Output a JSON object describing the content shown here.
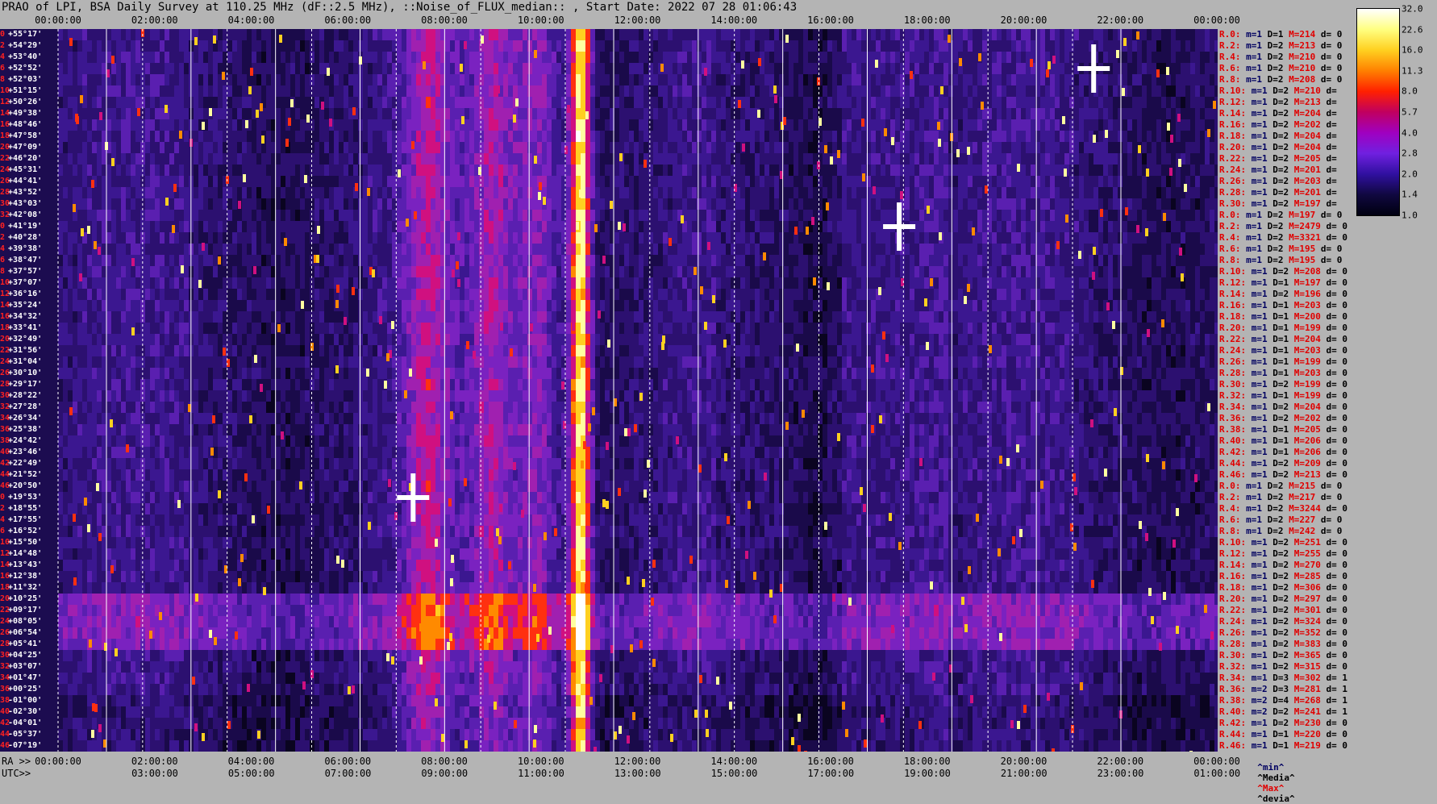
{
  "title": "PRAO of LPI, BSA Daily Survey at 110.25 MHz (dF::2.5 MHz), ::Noise_of_FLUX_median:: , Start Date: 2022 07 28 01:06:43",
  "chart_data": {
    "type": "heatmap",
    "title": "PRAO of LPI, BSA Daily Survey at 110.25 MHz (dF::2.5 MHz), ::Noise_of_FLUX_median:: , Start Date: 2022 07 28 01:06:43",
    "top_axis_labels": [
      "00:00:00",
      "02:00:00",
      "04:00:00",
      "06:00:00",
      "08:00:00",
      "10:00:00",
      "12:00:00",
      "14:00:00",
      "16:00:00",
      "18:00:00",
      "20:00:00",
      "22:00:00",
      "00:00:00"
    ],
    "ra_prefix": "RA >>",
    "ra_labels": [
      "00:00:00",
      "02:00:00",
      "04:00:00",
      "06:00:00",
      "08:00:00",
      "10:00:00",
      "12:00:00",
      "14:00:00",
      "16:00:00",
      "18:00:00",
      "20:00:00",
      "22:00:00",
      "00:00:00"
    ],
    "utc_prefix": "UTC>>",
    "utc_labels": [
      "03:00:00",
      "05:00:00",
      "07:00:00",
      "09:00:00",
      "11:00:00",
      "13:00:00",
      "15:00:00",
      "17:00:00",
      "19:00:00",
      "21:00:00",
      "23:00:00",
      "01:00:00"
    ],
    "dec_labels": [
      {
        "idx": "0",
        "dec": "+55°17'"
      },
      {
        "idx": "2",
        "dec": "+54°29'"
      },
      {
        "idx": "4",
        "dec": "+53°40'"
      },
      {
        "idx": "6",
        "dec": "+52°52'"
      },
      {
        "idx": "8",
        "dec": "+52°03'"
      },
      {
        "idx": "10",
        "dec": "+51°15'"
      },
      {
        "idx": "12",
        "dec": "+50°26'"
      },
      {
        "idx": "14",
        "dec": "+49°38'"
      },
      {
        "idx": "16",
        "dec": "+48°46'"
      },
      {
        "idx": "18",
        "dec": "+47°58'"
      },
      {
        "idx": "20",
        "dec": "+47°09'"
      },
      {
        "idx": "22",
        "dec": "+46°20'"
      },
      {
        "idx": "24",
        "dec": "+45°31'"
      },
      {
        "idx": "26",
        "dec": "+44°41'"
      },
      {
        "idx": "28",
        "dec": "+43°52'"
      },
      {
        "idx": "30",
        "dec": "+43°03'"
      },
      {
        "idx": "32",
        "dec": "+42°08'"
      },
      {
        "idx": "0",
        "dec": "+41°19'"
      },
      {
        "idx": "2",
        "dec": "+40°28'"
      },
      {
        "idx": "4",
        "dec": "+39°38'"
      },
      {
        "idx": "6",
        "dec": "+38°47'"
      },
      {
        "idx": "8",
        "dec": "+37°57'"
      },
      {
        "idx": "10",
        "dec": "+37°07'"
      },
      {
        "idx": "12",
        "dec": "+36°16'"
      },
      {
        "idx": "14",
        "dec": "+35°24'"
      },
      {
        "idx": "16",
        "dec": "+34°32'"
      },
      {
        "idx": "18",
        "dec": "+33°41'"
      },
      {
        "idx": "20",
        "dec": "+32°49'"
      },
      {
        "idx": "22",
        "dec": "+31°56'"
      },
      {
        "idx": "24",
        "dec": "+31°04'"
      },
      {
        "idx": "26",
        "dec": "+30°10'"
      },
      {
        "idx": "28",
        "dec": "+29°17'"
      },
      {
        "idx": "30",
        "dec": "+28°22'"
      },
      {
        "idx": "32",
        "dec": "+27°28'"
      },
      {
        "idx": "34",
        "dec": "+26°34'"
      },
      {
        "idx": "36",
        "dec": "+25°38'"
      },
      {
        "idx": "38",
        "dec": "+24°42'"
      },
      {
        "idx": "40",
        "dec": "+23°46'"
      },
      {
        "idx": "42",
        "dec": "+22°49'"
      },
      {
        "idx": "44",
        "dec": "+21°52'"
      },
      {
        "idx": "46",
        "dec": "+20°50'"
      },
      {
        "idx": "0",
        "dec": "+19°53'"
      },
      {
        "idx": "2",
        "dec": "+18°55'"
      },
      {
        "idx": "4",
        "dec": "+17°55'"
      },
      {
        "idx": "6",
        "dec": "+16°52'"
      },
      {
        "idx": "10",
        "dec": "+15°50'"
      },
      {
        "idx": "12",
        "dec": "+14°48'"
      },
      {
        "idx": "14",
        "dec": "+13°43'"
      },
      {
        "idx": "16",
        "dec": "+12°38'"
      },
      {
        "idx": "18",
        "dec": "+11°32'"
      },
      {
        "idx": "20",
        "dec": "+10°25'"
      },
      {
        "idx": "22",
        "dec": "+09°17'"
      },
      {
        "idx": "24",
        "dec": "+08°05'"
      },
      {
        "idx": "26",
        "dec": "+06°54'"
      },
      {
        "idx": "28",
        "dec": "+05°41'"
      },
      {
        "idx": "30",
        "dec": "+04°25'"
      },
      {
        "idx": "32",
        "dec": "+03°07'"
      },
      {
        "idx": "34",
        "dec": "+01°47'"
      },
      {
        "idx": "36",
        "dec": "+00°25'"
      },
      {
        "idx": "38",
        "dec": "-01°00'"
      },
      {
        "idx": "40",
        "dec": "-02°30'"
      },
      {
        "idx": "42",
        "dec": "-04°01'"
      },
      {
        "idx": "44",
        "dec": "-05°37'"
      },
      {
        "idx": "46",
        "dec": "-07°19'"
      }
    ],
    "stats": [
      {
        "r": "R.0:",
        "m": "m=1",
        "d": "D=1",
        "max": "M=214",
        "dev": "d= 0"
      },
      {
        "r": "R.2:",
        "m": "m=1",
        "d": "D=2",
        "max": "M=213",
        "dev": "d= 0"
      },
      {
        "r": "R.4:",
        "m": "m=1",
        "d": "D=2",
        "max": "M=210",
        "dev": "d= 0"
      },
      {
        "r": "R.6:",
        "m": "m=1",
        "d": "D=2",
        "max": "M=210",
        "dev": "d= 0"
      },
      {
        "r": "R.8:",
        "m": "m=1",
        "d": "D=2",
        "max": "M=208",
        "dev": "d= 0"
      },
      {
        "r": "R.10:",
        "m": "m=1",
        "d": "D=2",
        "max": "M=210",
        "dev": "d="
      },
      {
        "r": "R.12:",
        "m": "m=1",
        "d": "D=2",
        "max": "M=213",
        "dev": "d="
      },
      {
        "r": "R.14:",
        "m": "m=1",
        "d": "D=2",
        "max": "M=204",
        "dev": "d="
      },
      {
        "r": "R.16:",
        "m": "m=1",
        "d": "D=2",
        "max": "M=202",
        "dev": "d="
      },
      {
        "r": "R.18:",
        "m": "m=1",
        "d": "D=2",
        "max": "M=204",
        "dev": "d="
      },
      {
        "r": "R.20:",
        "m": "m=1",
        "d": "D=2",
        "max": "M=204",
        "dev": "d="
      },
      {
        "r": "R.22:",
        "m": "m=1",
        "d": "D=2",
        "max": "M=205",
        "dev": "d="
      },
      {
        "r": "R.24:",
        "m": "m=1",
        "d": "D=2",
        "max": "M=201",
        "dev": "d="
      },
      {
        "r": "R.26:",
        "m": "m=1",
        "d": "D=2",
        "max": "M=203",
        "dev": "d="
      },
      {
        "r": "R.28:",
        "m": "m=1",
        "d": "D=2",
        "max": "M=201",
        "dev": "d="
      },
      {
        "r": "R.30:",
        "m": "m=1",
        "d": "D=2",
        "max": "M=197",
        "dev": "d="
      },
      {
        "r": "R.0:",
        "m": "m=1",
        "d": "D=2",
        "max": "M=197",
        "dev": "d= 0"
      },
      {
        "r": "R.2:",
        "m": "m=1",
        "d": "D=2",
        "max": "M=2479",
        "dev": "d= 0"
      },
      {
        "r": "R.4:",
        "m": "m=1",
        "d": "D=2",
        "max": "M=3321",
        "dev": "d= 0"
      },
      {
        "r": "R.6:",
        "m": "m=1",
        "d": "D=2",
        "max": "M=195",
        "dev": "d= 0"
      },
      {
        "r": "R.8:",
        "m": "m=1",
        "d": "D=2",
        "max": "M=195",
        "dev": "d= 0"
      },
      {
        "r": "R.10:",
        "m": "m=1",
        "d": "D=2",
        "max": "M=208",
        "dev": "d= 0"
      },
      {
        "r": "R.12:",
        "m": "m=1",
        "d": "D=1",
        "max": "M=197",
        "dev": "d= 0"
      },
      {
        "r": "R.14:",
        "m": "m=1",
        "d": "D=2",
        "max": "M=196",
        "dev": "d= 0"
      },
      {
        "r": "R.16:",
        "m": "m=1",
        "d": "D=1",
        "max": "M=203",
        "dev": "d= 0"
      },
      {
        "r": "R.18:",
        "m": "m=1",
        "d": "D=1",
        "max": "M=200",
        "dev": "d= 0"
      },
      {
        "r": "R.20:",
        "m": "m=1",
        "d": "D=1",
        "max": "M=199",
        "dev": "d= 0"
      },
      {
        "r": "R.22:",
        "m": "m=1",
        "d": "D=1",
        "max": "M=204",
        "dev": "d= 0"
      },
      {
        "r": "R.24:",
        "m": "m=1",
        "d": "D=1",
        "max": "M=203",
        "dev": "d= 0"
      },
      {
        "r": "R.26:",
        "m": "m=1",
        "d": "D=1",
        "max": "M=199",
        "dev": "d= 0"
      },
      {
        "r": "R.28:",
        "m": "m=1",
        "d": "D=1",
        "max": "M=203",
        "dev": "d= 0"
      },
      {
        "r": "R.30:",
        "m": "m=1",
        "d": "D=2",
        "max": "M=199",
        "dev": "d= 0"
      },
      {
        "r": "R.32:",
        "m": "m=1",
        "d": "D=1",
        "max": "M=199",
        "dev": "d= 0"
      },
      {
        "r": "R.34:",
        "m": "m=1",
        "d": "D=2",
        "max": "M=204",
        "dev": "d= 0"
      },
      {
        "r": "R.36:",
        "m": "m=1",
        "d": "D=2",
        "max": "M=202",
        "dev": "d= 0"
      },
      {
        "r": "R.38:",
        "m": "m=1",
        "d": "D=1",
        "max": "M=205",
        "dev": "d= 0"
      },
      {
        "r": "R.40:",
        "m": "m=1",
        "d": "D=1",
        "max": "M=206",
        "dev": "d= 0"
      },
      {
        "r": "R.42:",
        "m": "m=1",
        "d": "D=1",
        "max": "M=206",
        "dev": "d= 0"
      },
      {
        "r": "R.44:",
        "m": "m=1",
        "d": "D=2",
        "max": "M=209",
        "dev": "d= 0"
      },
      {
        "r": "R.46:",
        "m": "m=1",
        "d": "D=2",
        "max": "M=213",
        "dev": "d= 0"
      },
      {
        "r": "R.0:",
        "m": "m=1",
        "d": "D=2",
        "max": "M=215",
        "dev": "d= 0"
      },
      {
        "r": "R.2:",
        "m": "m=1",
        "d": "D=2",
        "max": "M=217",
        "dev": "d= 0"
      },
      {
        "r": "R.4:",
        "m": "m=1",
        "d": "D=2",
        "max": "M=3244",
        "dev": "d= 0"
      },
      {
        "r": "R.6:",
        "m": "m=1",
        "d": "D=2",
        "max": "M=227",
        "dev": "d= 0"
      },
      {
        "r": "R.8:",
        "m": "m=1",
        "d": "D=2",
        "max": "M=242",
        "dev": "d= 0"
      },
      {
        "r": "R.10:",
        "m": "m=1",
        "d": "D=2",
        "max": "M=251",
        "dev": "d= 0"
      },
      {
        "r": "R.12:",
        "m": "m=1",
        "d": "D=2",
        "max": "M=255",
        "dev": "d= 0"
      },
      {
        "r": "R.14:",
        "m": "m=1",
        "d": "D=2",
        "max": "M=270",
        "dev": "d= 0"
      },
      {
        "r": "R.16:",
        "m": "m=1",
        "d": "D=2",
        "max": "M=285",
        "dev": "d= 0"
      },
      {
        "r": "R.18:",
        "m": "m=1",
        "d": "D=2",
        "max": "M=306",
        "dev": "d= 0"
      },
      {
        "r": "R.20:",
        "m": "m=1",
        "d": "D=2",
        "max": "M=297",
        "dev": "d= 0"
      },
      {
        "r": "R.22:",
        "m": "m=1",
        "d": "D=2",
        "max": "M=301",
        "dev": "d= 0"
      },
      {
        "r": "R.24:",
        "m": "m=1",
        "d": "D=2",
        "max": "M=324",
        "dev": "d= 0"
      },
      {
        "r": "R.26:",
        "m": "m=1",
        "d": "D=2",
        "max": "M=352",
        "dev": "d= 0"
      },
      {
        "r": "R.28:",
        "m": "m=1",
        "d": "D=2",
        "max": "M=383",
        "dev": "d= 0"
      },
      {
        "r": "R.30:",
        "m": "m=1",
        "d": "D=2",
        "max": "M=365",
        "dev": "d= 0"
      },
      {
        "r": "R.32:",
        "m": "m=1",
        "d": "D=2",
        "max": "M=315",
        "dev": "d= 0"
      },
      {
        "r": "R.34:",
        "m": "m=1",
        "d": "D=3",
        "max": "M=302",
        "dev": "d= 1"
      },
      {
        "r": "R.36:",
        "m": "m=2",
        "d": "D=3",
        "max": "M=281",
        "dev": "d= 1"
      },
      {
        "r": "R.38:",
        "m": "m=2",
        "d": "D=4",
        "max": "M=268",
        "dev": "d= 1"
      },
      {
        "r": "R.40:",
        "m": "m=2",
        "d": "D=2",
        "max": "M=241",
        "dev": "d= 1"
      },
      {
        "r": "R.42:",
        "m": "m=1",
        "d": "D=2",
        "max": "M=230",
        "dev": "d= 0"
      },
      {
        "r": "R.44:",
        "m": "m=1",
        "d": "D=1",
        "max": "M=220",
        "dev": "d= 0"
      },
      {
        "r": "R.46:",
        "m": "m=1",
        "d": "D=1",
        "max": "M=219",
        "dev": "d= 0"
      }
    ],
    "stats_legend": {
      "min": "^min^",
      "median": "^Media^",
      "max": "^Max^",
      "dev": "^devia^"
    },
    "colorbar": {
      "ticks": [
        "32.0",
        "22.6",
        "16.0",
        "11.3",
        "8.0",
        "5.7",
        "4.0",
        "2.8",
        "2.0",
        "1.4",
        "1.0"
      ],
      "colors": [
        "#ffffff",
        "#ffff80",
        "#ffd020",
        "#ff8000",
        "#ff2000",
        "#c00060",
        "#a000c0",
        "#7020e0",
        "#3010a0",
        "#100840",
        "#000010"
      ],
      "range": [
        1.0,
        32.0
      ],
      "scale": "log"
    },
    "bright_vertical_bands_ra_hours": [
      8.7,
      10.2,
      11.3,
      12.3
    ],
    "point_sources": [
      {
        "ra_hours": 8.4,
        "dec": "+19°53'"
      },
      {
        "ra_hours": 19.9,
        "dec": "+41°19'"
      },
      {
        "ra_hours": 24.5,
        "dec": "+52°52'"
      }
    ]
  }
}
